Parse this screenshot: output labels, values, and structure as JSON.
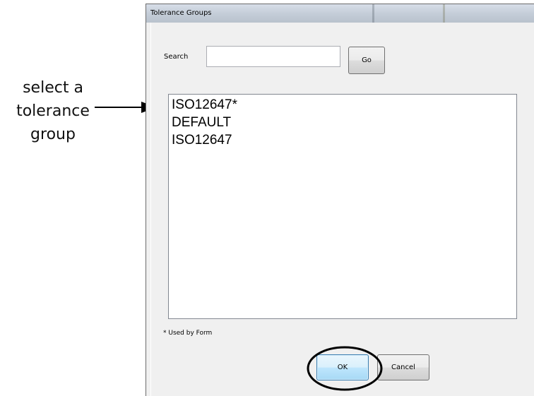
{
  "annotation": {
    "lines": [
      "select a",
      "tolerance",
      "group"
    ]
  },
  "dialog": {
    "title": "Tolerance Groups",
    "search": {
      "label": "Search",
      "value": "",
      "go_label": "Go"
    },
    "list_items": [
      "ISO12647*",
      "DEFAULT",
      "ISO12647"
    ],
    "footnote": "* Used by Form",
    "ok_label": "OK",
    "cancel_label": "Cancel"
  }
}
